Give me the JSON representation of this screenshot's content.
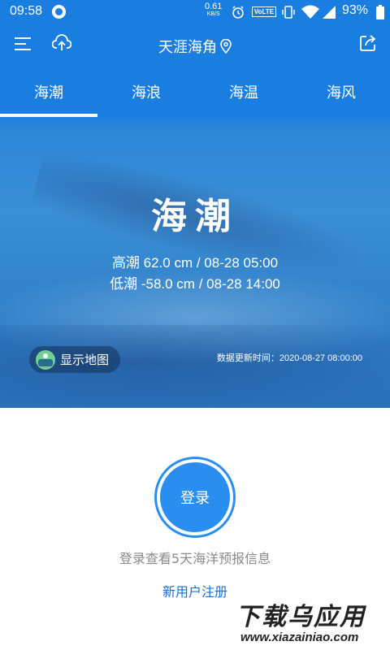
{
  "status_bar": {
    "time": "09:58",
    "net_speed": "0.61",
    "net_unit": "KB/S",
    "volte": "VoLTE",
    "battery": "93%"
  },
  "header": {
    "title": "天涯海角",
    "menu_icon": "menu-icon",
    "upload_icon": "cloud-upload-icon",
    "share_icon": "share-icon"
  },
  "tabs": [
    {
      "label": "海潮",
      "active": true
    },
    {
      "label": "海浪",
      "active": false
    },
    {
      "label": "海温",
      "active": false
    },
    {
      "label": "海风",
      "active": false
    }
  ],
  "hero": {
    "title": "海潮",
    "high_tide": "高潮 62.0 cm / 08-28 05:00",
    "low_tide": "低潮 -58.0 cm / 08-28 14:00",
    "map_button": "显示地图",
    "update_time": "数据更新时间：2020-08-27 08:00:00"
  },
  "login": {
    "button": "登录",
    "hint": "登录查看5天海洋预报信息",
    "register": "新用户注册"
  },
  "watermark": {
    "main": "下载乌应用",
    "url": "www.xiazainiao.com"
  },
  "colors": {
    "primary": "#1a7de0",
    "login": "#2a8ef0",
    "link": "#1a6fd1"
  }
}
